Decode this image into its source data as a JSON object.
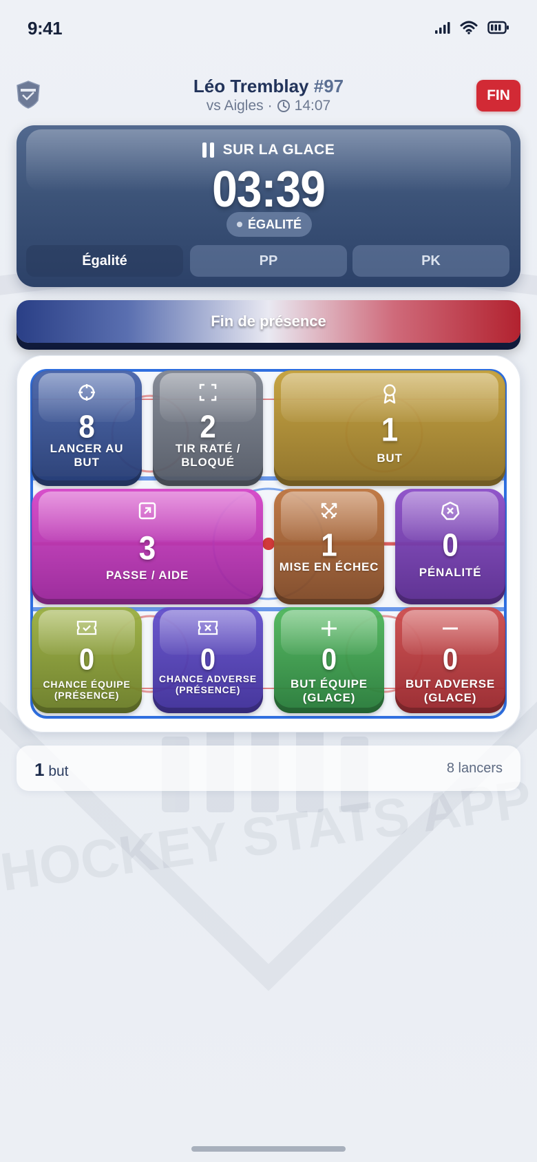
{
  "status_bar": {
    "time": "9:41"
  },
  "header": {
    "player_name": "Léo Tremblay",
    "player_number": "#97",
    "opponent": "vs Aigles",
    "separator": "·",
    "clock": "14:07",
    "end_button": "FIN"
  },
  "ice_panel": {
    "label": "SUR LA GLACE",
    "timer": "03:39",
    "strength": "ÉGALITÉ",
    "segments": [
      "Égalité",
      "PP",
      "PK"
    ],
    "selected_segment": "Égalité"
  },
  "end_shift_button": "Fin de présence",
  "stats": [
    {
      "label": "LANCER AU BUT",
      "value": "8",
      "color": "#2f4b8f",
      "icon": "crosshair-icon"
    },
    {
      "label": "TIR RATÉ / BLOQUÉ",
      "value": "2",
      "color": "#6b717d",
      "icon": "frame-corners-icon"
    },
    {
      "label": "BUT",
      "value": "1",
      "color": "#a8892e",
      "icon": "award-ribbon-icon"
    },
    {
      "label": "PASSE / AIDE",
      "value": "3",
      "color": "#bb35b8",
      "icon": "arrow-up-right-square-icon"
    },
    {
      "label": "MISE EN ÉCHEC",
      "value": "1",
      "color": "#9b5b30",
      "icon": "crossed-swords-icon"
    },
    {
      "label": "PÉNALITÉ",
      "value": "0",
      "color": "#6f3aa8",
      "icon": "x-circle-icon"
    },
    {
      "label": "CHANCE ÉQUIPE (PRÉSENCE)",
      "value": "0",
      "color": "#84982f",
      "icon": "ticket-check-icon"
    },
    {
      "label": "CHANCE ADVERSE (PRÉSENCE)",
      "value": "0",
      "color": "#4d3aae",
      "icon": "ticket-x-icon"
    },
    {
      "label": "BUT ÉQUIPE (GLACE)",
      "value": "0",
      "color": "#3a9a4a",
      "icon": "plus-icon"
    },
    {
      "label": "BUT ADVERSE (GLACE)",
      "value": "0",
      "color": "#b63a3f",
      "icon": "minus-icon"
    }
  ],
  "summary": {
    "goals_count": "1",
    "goals_label": "but",
    "shots": "8 lancers"
  },
  "watermark": "HOCKEY STATS APP"
}
